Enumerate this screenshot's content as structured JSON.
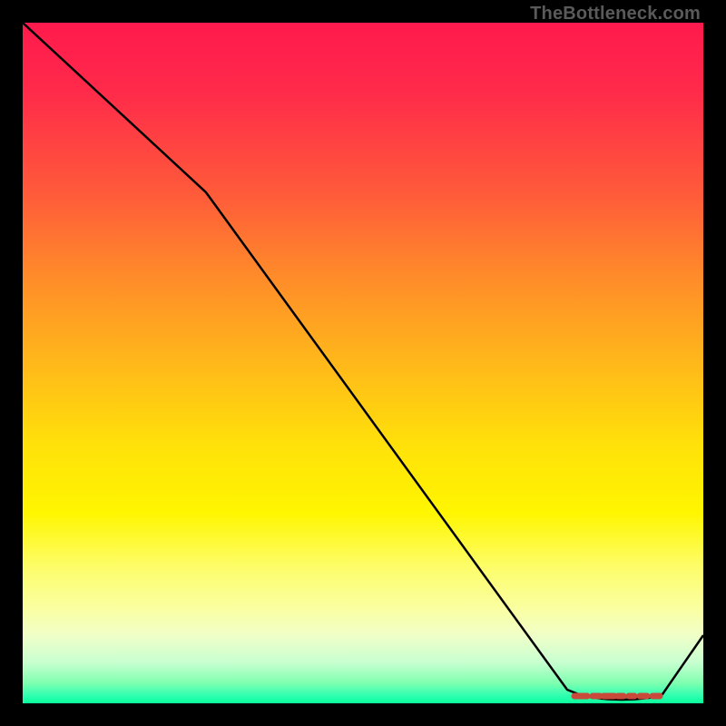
{
  "attribution": "TheBottleneck.com",
  "chart_data": {
    "type": "line",
    "title": "",
    "xlabel": "",
    "ylabel": "",
    "xlim": [
      0,
      100
    ],
    "ylim": [
      0,
      100
    ],
    "grid": false,
    "legend": false,
    "series": [
      {
        "name": "curve",
        "x": [
          0,
          27,
          80,
          82,
          84,
          86,
          88,
          90,
          92,
          94,
          100
        ],
        "values": [
          100,
          75,
          2,
          1.2,
          0.8,
          0.6,
          0.5,
          0.6,
          0.8,
          1.4,
          10
        ],
        "color": "#000000",
        "markers": false
      },
      {
        "name": "baseline-dash",
        "x": [
          81,
          83,
          84.5,
          86,
          87.5,
          89.5,
          92,
          93.5
        ],
        "values": [
          1,
          1,
          1,
          1,
          1,
          1,
          1,
          1
        ],
        "color": "#c94a3a",
        "markers": true
      }
    ]
  }
}
